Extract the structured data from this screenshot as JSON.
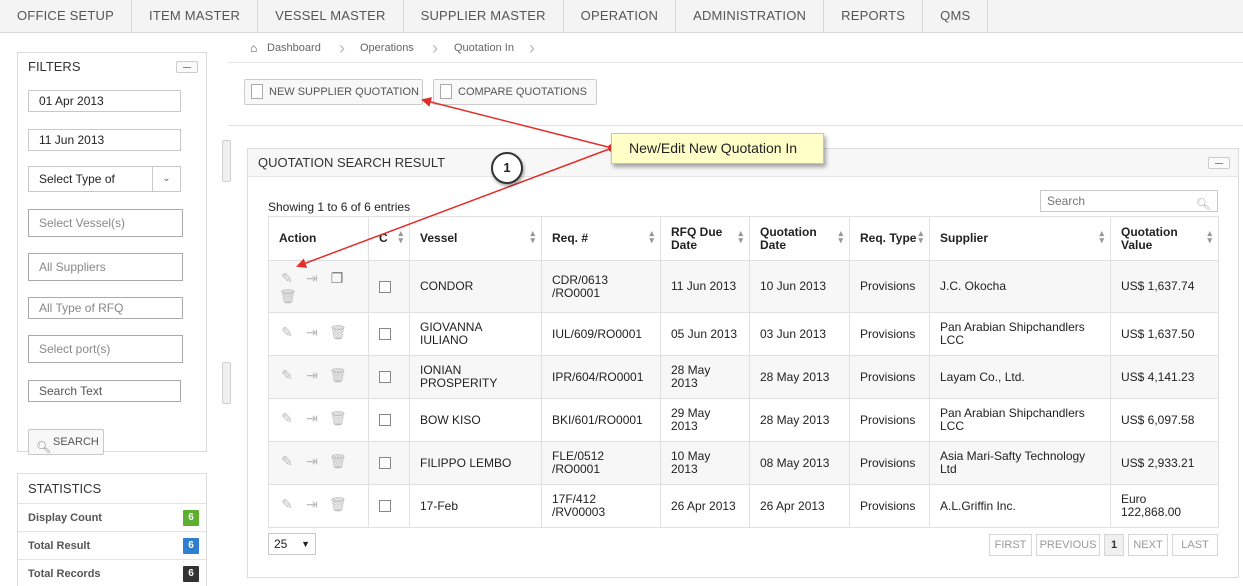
{
  "nav": [
    "OFFICE SETUP",
    "ITEM MASTER",
    "VESSEL MASTER",
    "SUPPLIER MASTER",
    "OPERATION",
    "ADMINISTRATION",
    "REPORTS",
    "QMS"
  ],
  "filters": {
    "title": "FILTERS",
    "date_from": "01 Apr 2013",
    "date_to": "11 Jun 2013",
    "type_select": "Select Type of",
    "vessels_placeholder": "Select Vessel(s)",
    "suppliers_placeholder": "All Suppliers",
    "rfq_placeholder": "All Type of RFQ",
    "ports_placeholder": "Select port(s)",
    "search_text_placeholder": "Search Text",
    "search_button": "SEARCH"
  },
  "statistics": {
    "title": "STATISTICS",
    "rows": [
      {
        "label": "Display Count",
        "value": "6",
        "color": "#5cb030"
      },
      {
        "label": "Total Result",
        "value": "6",
        "color": "#2f7fd0"
      },
      {
        "label": "Total Records",
        "value": "6",
        "color": "#333333"
      }
    ]
  },
  "breadcrumb": [
    "Dashboard",
    "Operations",
    "Quotation In"
  ],
  "actions": {
    "new_quotation": "NEW SUPPLIER QUOTATION",
    "compare": "COMPARE QUOTATIONS"
  },
  "results": {
    "title": "QUOTATION SEARCH RESULT",
    "showing": "Showing 1 to 6 of 6 entries",
    "search_placeholder": "Search",
    "columns": [
      "Action",
      "C",
      "Vessel",
      "Req. #",
      "RFQ Due Date",
      "Quotation Date",
      "Req. Type",
      "Supplier",
      "Quotation Value"
    ],
    "rows": [
      {
        "vessel": "CONDOR",
        "req": "CDR/0613 /RO0001",
        "rfq_due": "11 Jun 2013",
        "q_date": "10 Jun 2013",
        "type": "Provisions",
        "supplier": "J.C. Okocha",
        "value": "US$ 1,637.74"
      },
      {
        "vessel": "GIOVANNA IULIANO",
        "req": "IUL/609/RO0001",
        "rfq_due": "05 Jun 2013",
        "q_date": "03 Jun 2013",
        "type": "Provisions",
        "supplier": "Pan Arabian Shipchandlers LCC",
        "value": "US$ 1,637.50"
      },
      {
        "vessel": "IONIAN PROSPERITY",
        "req": "IPR/604/RO0001",
        "rfq_due": "28 May 2013",
        "q_date": "28 May 2013",
        "type": "Provisions",
        "supplier": "Layam Co., Ltd.",
        "value": "US$ 4,141.23"
      },
      {
        "vessel": "BOW KISO",
        "req": "BKI/601/RO0001",
        "rfq_due": "29 May 2013",
        "q_date": "28 May 2013",
        "type": "Provisions",
        "supplier": "Pan Arabian Shipchandlers LCC",
        "value": "US$ 6,097.58"
      },
      {
        "vessel": "FILIPPO LEMBO",
        "req": "FLE/0512 /RO0001",
        "rfq_due": "10 May 2013",
        "q_date": "08 May 2013",
        "type": "Provisions",
        "supplier": "Asia Mari-Safty Technology Ltd",
        "value": "US$ 2,933.21"
      },
      {
        "vessel": "17-Feb",
        "req": "17F/412 /RV00003",
        "rfq_due": "26 Apr 2013",
        "q_date": "26 Apr 2013",
        "type": "Provisions",
        "supplier": "A.L.Griffin Inc.",
        "value": "Euro 122,868.00"
      }
    ],
    "page_size": "25",
    "pager": {
      "first": "FIRST",
      "previous": "PREVIOUS",
      "page": "1",
      "next": "NEXT",
      "last": "LAST"
    }
  },
  "annotation": {
    "callout": "New/Edit New Quotation In",
    "step": "1",
    "color": "#e0302a"
  }
}
